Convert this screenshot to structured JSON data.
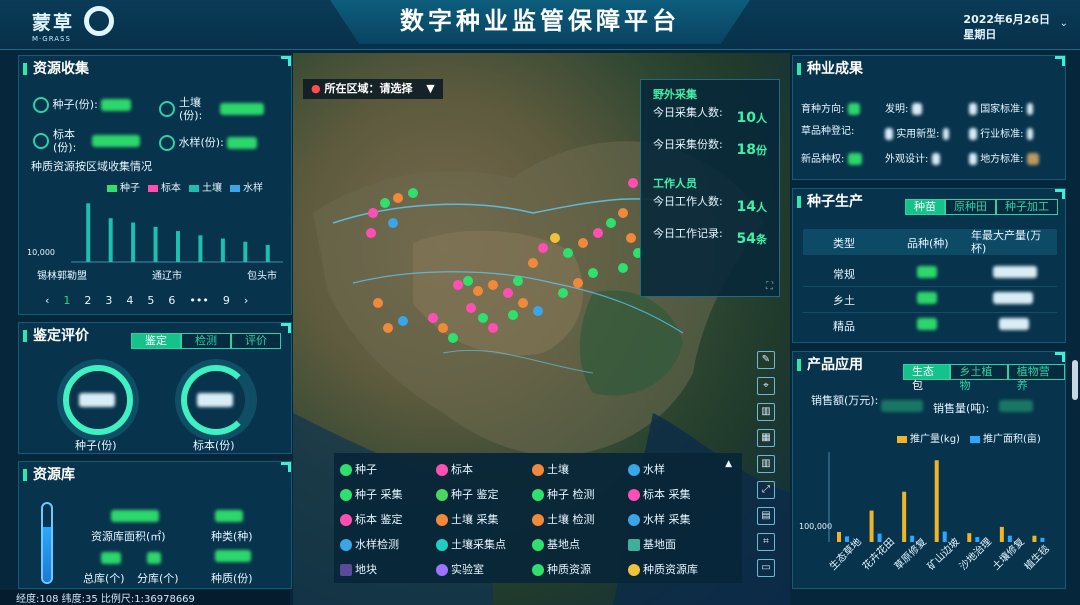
{
  "header": {
    "logo_text": "蒙草",
    "logo_sub": "M·GRASS",
    "title": "数字种业监管保障平台",
    "date": "2022年6月26日",
    "weekday": "星期日"
  },
  "resource_collection": {
    "title": "资源收集",
    "stats": [
      {
        "label": "种子(份):",
        "icon": "seed-icon"
      },
      {
        "label": "土壤\n(份):",
        "icon": "soil-icon"
      },
      {
        "label": "标本\n(份):",
        "icon": "specimen-icon"
      },
      {
        "label": "水样(份):",
        "icon": "water-icon"
      }
    ],
    "subtitle": "种质资源按区域收集情况",
    "legend": [
      {
        "name": "种子",
        "color": "#2fe06d"
      },
      {
        "name": "标本",
        "color": "#ff4fb4"
      },
      {
        "name": "土壤",
        "color": "#1fbfb0"
      },
      {
        "name": "水样",
        "color": "#3aa6e8"
      }
    ],
    "y_tick": "10,000",
    "x_labels": [
      "锡林郭勒盟",
      "通辽市",
      "包头市"
    ],
    "pagination": [
      "‹",
      "1",
      "2",
      "3",
      "4",
      "5",
      "6",
      "•••",
      "9",
      "›"
    ]
  },
  "chart_data": {
    "type": "bar",
    "categories": [
      "锡林郭勒盟",
      "",
      "",
      "通辽市",
      "",
      "",
      "包头市",
      "",
      ""
    ],
    "values": [
      55000,
      41000,
      37000,
      33000,
      29000,
      25000,
      22000,
      19000,
      16000
    ],
    "ylabel": "",
    "ytick_shown": "10,000"
  },
  "evaluation": {
    "title": "鉴定评价",
    "tabs": [
      "鉴定",
      "检测",
      "评价"
    ],
    "gauges": [
      {
        "label": "种子(份)"
      },
      {
        "label": "标本(份)"
      }
    ]
  },
  "resource_library": {
    "title": "资源库",
    "items": [
      {
        "label": "资源库面积(㎡)"
      },
      {
        "label": "种类(种)"
      },
      {
        "label": "总库(个)"
      },
      {
        "label": "分库(个)"
      },
      {
        "label": "种质(份)"
      }
    ]
  },
  "map": {
    "region_label": "所在区域：请选择",
    "field_title": "野外采集",
    "today_collect_people_label": "今日采集人数:",
    "today_collect_people_value": "10",
    "today_collect_people_unit": "人",
    "today_collect_copies_label": "今日采集份数:",
    "today_collect_copies_value": "18",
    "today_collect_copies_unit": "份",
    "staff_title": "工作人员",
    "today_staff_label": "今日工作人数:",
    "today_staff_value": "14",
    "today_staff_unit": "人",
    "today_records_label": "今日工作记录:",
    "today_records_value": "54",
    "today_records_unit": "条",
    "legend": [
      {
        "label": "种子",
        "color": "#2fe06d"
      },
      {
        "label": "标本",
        "color": "#ff4fb4"
      },
      {
        "label": "土壤",
        "color": "#f08a3a"
      },
      {
        "label": "水样",
        "color": "#3aa6e8"
      },
      {
        "label": "种子 采集",
        "color": "#2fe06d"
      },
      {
        "label": "种子 鉴定",
        "color": "#4bd65f"
      },
      {
        "label": "种子 检测",
        "color": "#2fe06d"
      },
      {
        "label": "标本 采集",
        "color": "#ff4fb4"
      },
      {
        "label": "标本 鉴定",
        "color": "#ff4fb4"
      },
      {
        "label": "土壤 采集",
        "color": "#f08a3a"
      },
      {
        "label": "土壤 检测",
        "color": "#f08a3a"
      },
      {
        "label": "水样 采集",
        "color": "#3aa6e8"
      },
      {
        "label": "水样检测",
        "color": "#3aa6e8"
      },
      {
        "label": "土壤采集点",
        "color": "#1fd0c0"
      },
      {
        "label": "基地点",
        "color": "#2fe06d"
      },
      {
        "label": "基地面",
        "color": "#3fae9a"
      },
      {
        "label": "地块",
        "color": "#5a4a9a"
      },
      {
        "label": "实验室",
        "color": "#a070ff"
      },
      {
        "label": "种质资源",
        "color": "#2fe06d"
      },
      {
        "label": "种质资源库",
        "color": "#f0c23a"
      }
    ],
    "status": "经度:108  纬度:35  比例尺:1:36978669"
  },
  "seed_results": {
    "title": "种业成果",
    "items": [
      {
        "label": "育种方向:"
      },
      {
        "label": "发明:"
      },
      {
        "label": "国家标准:"
      },
      {
        "label": "草品种登记:"
      },
      {
        "label": "实用新型:"
      },
      {
        "label": "行业标准:"
      },
      {
        "label": "新品种权:"
      },
      {
        "label": "外观设计:"
      },
      {
        "label": "地方标准:"
      }
    ]
  },
  "seed_production": {
    "title": "种子生产",
    "tabs": [
      "种苗",
      "原种田",
      "种子加工"
    ],
    "headers": [
      "类型",
      "品种(种)",
      "年最大产量(万杯)"
    ],
    "rows": [
      {
        "type": "常规"
      },
      {
        "type": "乡土"
      },
      {
        "type": "精品"
      }
    ]
  },
  "product_app": {
    "title": "产品应用",
    "tabs": [
      "生态包",
      "乡土植物",
      "植物营养"
    ],
    "sales_amount_label": "销售额(万元):",
    "sales_volume_label": "销售量(吨):",
    "legend": [
      {
        "name": "推广量(kg)",
        "color": "#f0b429"
      },
      {
        "name": "推广面积(亩)",
        "color": "#2aa7ff"
      }
    ],
    "y_tick": "100,000",
    "categories": [
      "生态草地",
      "花卉花田",
      "草原修复",
      "矿山边坡",
      "沙地治理",
      "土壤修复",
      "植生毯"
    ],
    "values_kg": [
      8000,
      25000,
      40000,
      65000,
      7000,
      12000,
      5000
    ],
    "values_area": [
      800,
      1200,
      900,
      1500,
      700,
      900,
      600
    ]
  }
}
